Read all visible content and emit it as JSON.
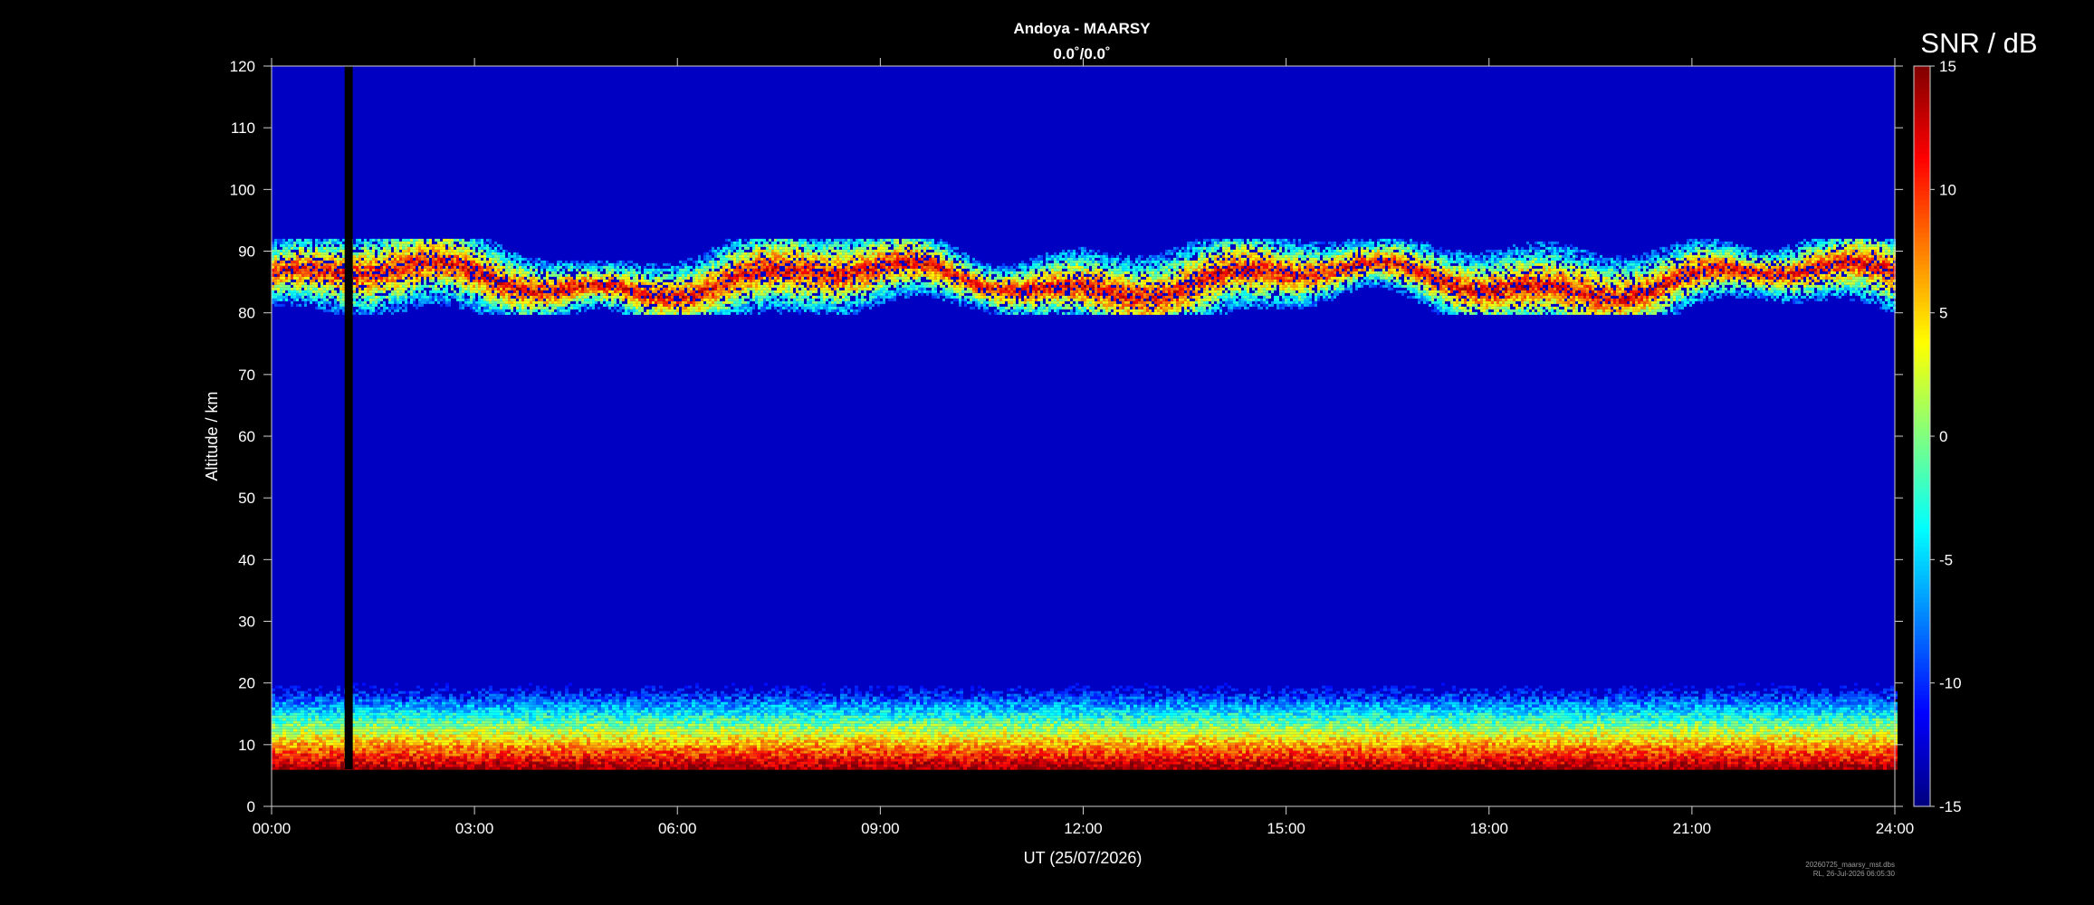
{
  "chart_data": {
    "type": "heatmap",
    "title": "Andoya - MAARSY",
    "subtitle": "0.0˚/0.0˚",
    "xlabel": "UT (25/07/2026)",
    "ylabel": "Altitude / km",
    "colorbar_label": "SNR / dB",
    "x_ticks": [
      "00:00",
      "03:00",
      "06:00",
      "09:00",
      "12:00",
      "15:00",
      "18:00",
      "21:00",
      "24:00"
    ],
    "x_range_hours": [
      0,
      24
    ],
    "y_ticks": [
      0,
      10,
      20,
      30,
      40,
      50,
      60,
      70,
      80,
      90,
      100,
      110,
      120
    ],
    "ylim": [
      0,
      120
    ],
    "color_ticks": [
      15,
      10,
      5,
      0,
      -5,
      -10,
      -15
    ],
    "color_range": [
      -15,
      15
    ],
    "colormap": "jet",
    "background_snr_db": -13,
    "data_gap": {
      "start_hour": 1.08,
      "end_hour": 1.2,
      "min_km": 6,
      "max_km": 120
    },
    "data_min_altitude_km": 6,
    "layers": [
      {
        "region": "mesosphere",
        "altitude_km": [
          80,
          92
        ],
        "time_h": [
          0,
          24
        ],
        "peak_snr_db": 15
      },
      {
        "region": "lower atmosphere",
        "altitude_km": [
          6,
          20
        ],
        "time_h": [
          0,
          24
        ],
        "peak_snr_db": 15
      }
    ],
    "grid": false
  },
  "footer": {
    "line1": "20260725_maarsy_mst.dbs",
    "line2": "RL, 26-Jul-2026 06:05:30"
  }
}
